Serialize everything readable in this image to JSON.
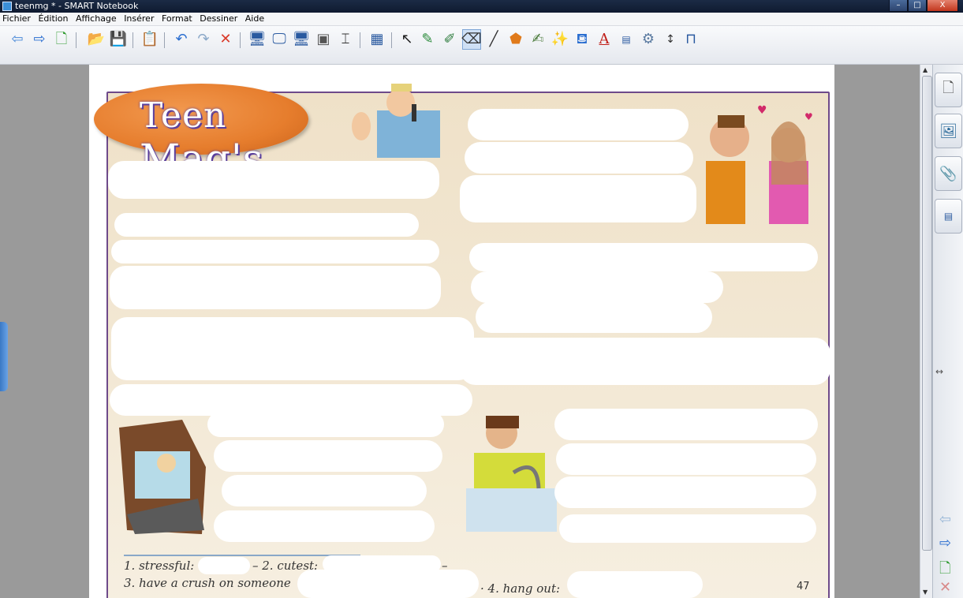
{
  "window": {
    "title": "teenmg * - SMART Notebook",
    "buttons": {
      "minimize": "–",
      "maximize": "□",
      "close": "X"
    }
  },
  "menu": [
    "Fichier",
    "Édition",
    "Affichage",
    "Insérer",
    "Format",
    "Dessiner",
    "Aide"
  ],
  "toolbar": {
    "icons": [
      "back-arrow-icon",
      "forward-arrow-icon",
      "add-page-icon",
      "open-folder-icon",
      "save-icon",
      "paste-icon",
      "undo-icon",
      "redo-icon",
      "delete-icon",
      "screen-shade-icon",
      "full-screen-icon",
      "dual-display-icon",
      "capture-icon",
      "document-camera-icon",
      "table-icon",
      "select-arrow-icon",
      "pen-icon",
      "creative-pen-icon",
      "eraser-icon",
      "line-icon",
      "shapes-icon",
      "magic-pen-icon",
      "fill-icon",
      "text-icon",
      "properties-icon",
      "measure-icon",
      "move-toolbar-icon",
      "presentation-icon"
    ]
  },
  "page": {
    "logo": {
      "part1": "Teen",
      "part2": "Mag's"
    },
    "exercises": {
      "item1": "1. stressful:",
      "item2": "– 2. cutest:",
      "dash": "–",
      "item3": "3. have a crush on someone",
      "item4": "· 4. hang out:"
    },
    "page_number": "47"
  },
  "side_panel": {
    "tabs": [
      "page-sorter-icon",
      "gallery-icon",
      "attachments-icon",
      "properties-icon"
    ],
    "nav": [
      "previous-page-icon",
      "next-page-icon",
      "add-page-icon",
      "delete-page-icon"
    ]
  }
}
